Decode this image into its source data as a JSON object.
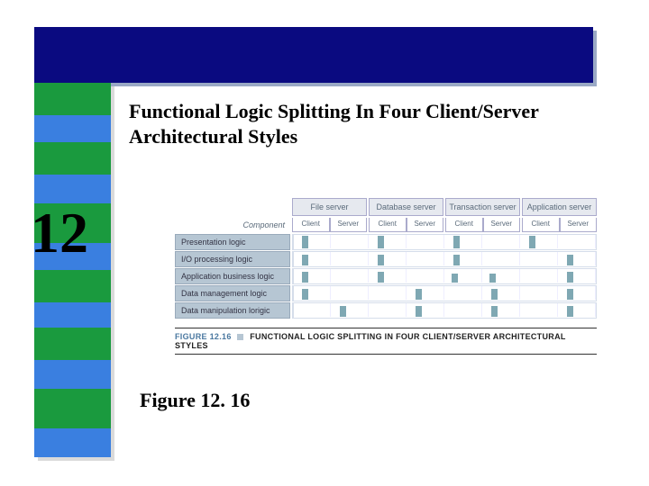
{
  "slide": {
    "title": "Functional Logic Splitting In Four Client/Server Architectural Styles",
    "chapter_number": "12",
    "figure_label": "Figure 12. 16"
  },
  "figure": {
    "caption_prefix": "FIGURE 12.16",
    "caption_text": "FUNCTIONAL LOGIC SPLITTING IN FOUR CLIENT/SERVER ARCHITECTURAL STYLES",
    "component_label": "Component",
    "server_types": [
      "File server",
      "Database server",
      "Transaction server",
      "Application server"
    ],
    "subheaders": [
      "Client",
      "Server"
    ],
    "rows": [
      "Presentation logic",
      "I/O processing logic",
      "Application business logic",
      "Data management logic",
      "Data manipulation lorigic"
    ]
  },
  "chart_data": {
    "type": "table",
    "title": "Functional Logic Splitting In Four Client/Server Architectural Styles",
    "columns": [
      "File server / Client",
      "File server / Server",
      "Database server / Client",
      "Database server / Server",
      "Transaction server / Client",
      "Transaction server / Server",
      "Application server / Client",
      "Application server / Server"
    ],
    "rows": [
      "Presentation logic",
      "I/O processing logic",
      "Application business logic",
      "Data management logic",
      "Data manipulation logic"
    ],
    "note": "Bars indicate presence/degree of each logic component on client vs server for each architectural style; exact magnitudes not labeled in source."
  }
}
